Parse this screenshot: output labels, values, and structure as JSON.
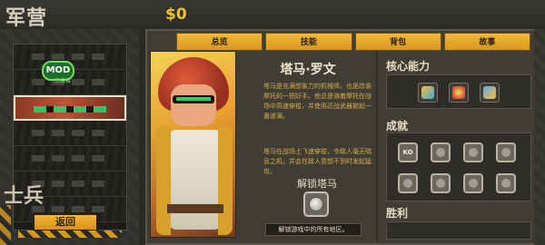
{
  "header": {
    "title": "军营",
    "money": "$0"
  },
  "sidebar": {
    "subtitle": "士兵",
    "mod_badge": "MOD",
    "mod_sub": "二周目",
    "back_label": "返回"
  },
  "tabs": [
    {
      "label": "总览"
    },
    {
      "label": "技能"
    },
    {
      "label": "背包"
    },
    {
      "label": "故事"
    }
  ],
  "character": {
    "name": "塔马·罗文",
    "desc1": "塔马是充满想象力的机械师，也是改装摩托的一把好手。他总是骑着摩托在战场中高速穿梭，并使用近战武器掀起一番波澜。",
    "desc2": "塔马在战场上飞速穿梭，令敌人毫无喘息之机，并会在敌人意想不到时发起猛攻。",
    "unlock_title": "解锁塔马",
    "unlock_requirement": "解锁游戏中的所有地区。"
  },
  "panels": {
    "skills_title": "核心能力",
    "achievements_title": "成就",
    "wins_title": "胜利"
  },
  "achievements": [
    {
      "icon": "ko-icon",
      "label": "KO"
    },
    {
      "icon": "achievement-icon"
    },
    {
      "icon": "achievement-icon"
    },
    {
      "icon": "achievement-icon"
    },
    {
      "icon": "achievement-icon"
    },
    {
      "icon": "achievement-icon"
    },
    {
      "icon": "achievement-icon"
    },
    {
      "icon": "achievement-icon"
    }
  ],
  "skills": [
    {
      "icon": "rocket-dash-icon"
    },
    {
      "icon": "explosion-icon"
    },
    {
      "icon": "motorbike-icon"
    }
  ],
  "colors": {
    "accent": "#f1c232",
    "tab": "#e3a82c",
    "panel": "#403d35",
    "desc_text": "#d8ab4a"
  }
}
